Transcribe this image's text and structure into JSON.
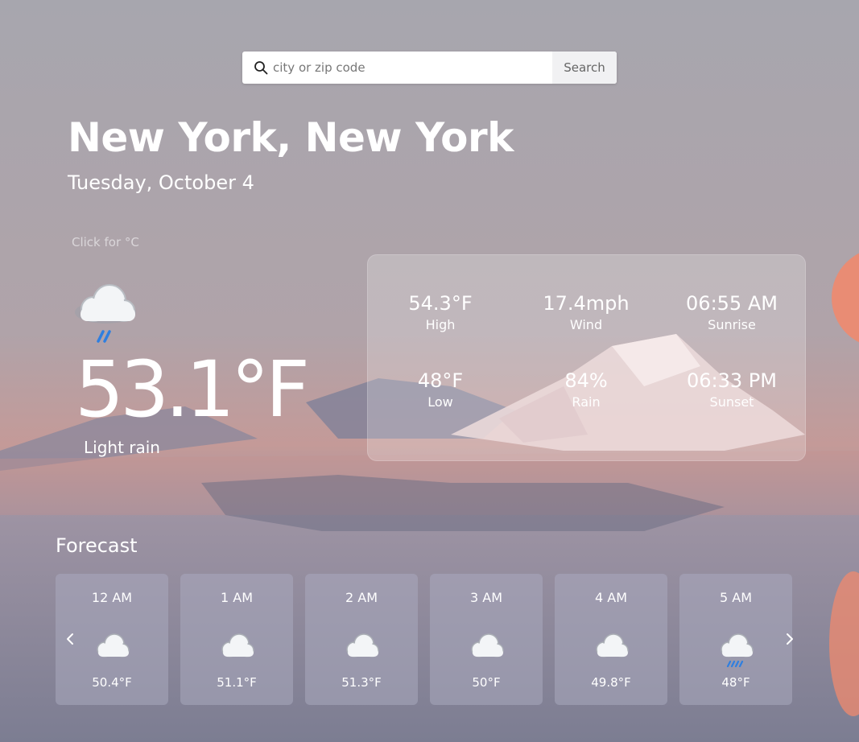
{
  "search": {
    "placeholder": "city or zip code",
    "value": "",
    "button_label": "Search",
    "icon": "search-icon"
  },
  "location": {
    "city": "New York, New York",
    "date": "Tuesday, October 4"
  },
  "unit_toggle": "Click for °C",
  "current": {
    "icon": "light-rain-icon",
    "temperature": "53.1°F",
    "condition": "Light rain"
  },
  "details": [
    {
      "value": "54.3°F",
      "label": "High"
    },
    {
      "value": "17.4mph",
      "label": "Wind"
    },
    {
      "value": "06:55 AM",
      "label": "Sunrise"
    },
    {
      "value": "48°F",
      "label": "Low"
    },
    {
      "value": "84%",
      "label": "Rain"
    },
    {
      "value": "06:33 PM",
      "label": "Sunset"
    }
  ],
  "forecast": {
    "title": "Forecast",
    "prev_icon": "chevron-left-icon",
    "next_icon": "chevron-right-icon",
    "items": [
      {
        "time": "12 AM",
        "icon": "cloud-icon",
        "temp": "50.4°F"
      },
      {
        "time": "1 AM",
        "icon": "cloud-icon",
        "temp": "51.1°F"
      },
      {
        "time": "2 AM",
        "icon": "cloud-icon",
        "temp": "51.3°F"
      },
      {
        "time": "3 AM",
        "icon": "cloud-icon",
        "temp": "50°F"
      },
      {
        "time": "4 AM",
        "icon": "cloud-icon",
        "temp": "49.8°F"
      },
      {
        "time": "5 AM",
        "icon": "rain-icon",
        "temp": "48°F"
      }
    ]
  },
  "colors": {
    "rain_accent": "#2f7fe0",
    "sun": "#f08a6e"
  }
}
